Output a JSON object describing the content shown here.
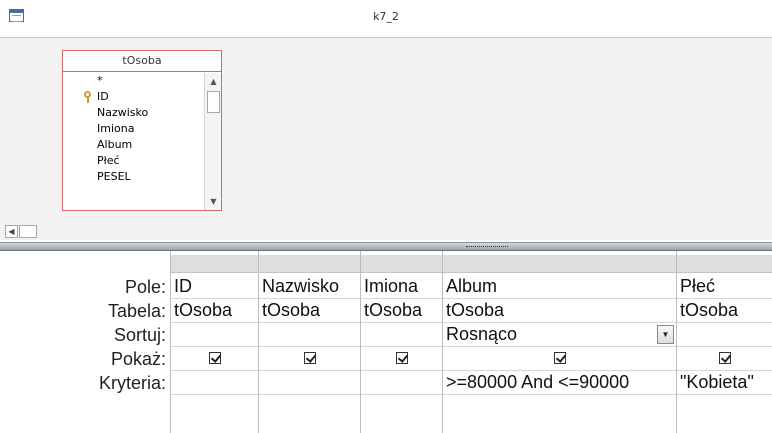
{
  "window": {
    "title": "k7_2"
  },
  "table": {
    "name": "tOsoba",
    "fields": [
      "*",
      "ID",
      "Nazwisko",
      "Imiona",
      "Album",
      "Płeć",
      "PESEL"
    ],
    "primary_key_field": "ID"
  },
  "grid": {
    "row_labels": {
      "field": "Pole:",
      "table": "Tabela:",
      "sort": "Sortuj:",
      "show": "Pokaż:",
      "criteria": "Kryteria:"
    },
    "columns": [
      {
        "field": "ID",
        "table": "tOsoba",
        "sort": "",
        "show": true,
        "criteria": ""
      },
      {
        "field": "Nazwisko",
        "table": "tOsoba",
        "sort": "",
        "show": true,
        "criteria": ""
      },
      {
        "field": "Imiona",
        "table": "tOsoba",
        "sort": "",
        "show": true,
        "criteria": ""
      },
      {
        "field": "Album",
        "table": "tOsoba",
        "sort": "Rosnąco",
        "show": true,
        "criteria": ">=80000 And <=90000"
      },
      {
        "field": "Płeć",
        "table": "tOsoba",
        "sort": "",
        "show": true,
        "criteria": "\"Kobieta\""
      }
    ]
  },
  "icons": {
    "app": "query-window-icon",
    "key": "primary-key-icon",
    "scroll_up": "scroll-up-arrow-icon",
    "scroll_down": "scroll-down-arrow-icon",
    "scroll_left": "scroll-left-arrow-icon",
    "dropdown": "dropdown-arrow-icon",
    "checkbox": "checkbox-checked-icon"
  },
  "colors": {
    "table_border": "#d46a6a",
    "pane_background": "#f2f2f2",
    "column_header": "#dedede"
  }
}
